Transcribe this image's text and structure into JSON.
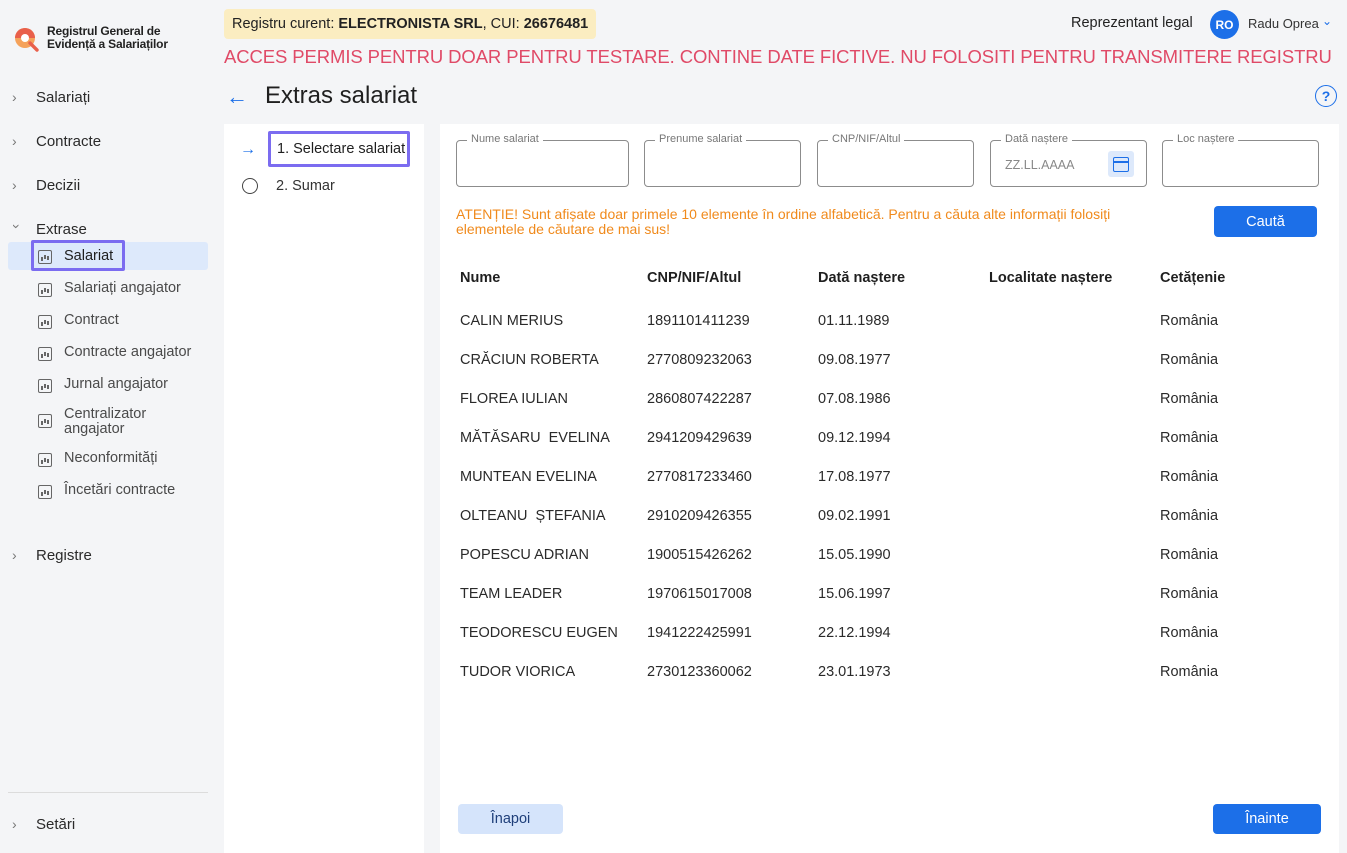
{
  "brand": {
    "line1": "Registrul General de",
    "line2": "Evidență a Salariaților"
  },
  "sidebar": {
    "groups": [
      {
        "label": "Salariați"
      },
      {
        "label": "Contracte"
      },
      {
        "label": "Decizii"
      },
      {
        "label": "Extrase"
      },
      {
        "label": "Registre"
      },
      {
        "label": "Setări"
      }
    ],
    "extrase_items": [
      {
        "label": "Salariat"
      },
      {
        "label": "Salariați angajator"
      },
      {
        "label": "Contract"
      },
      {
        "label": "Contracte angajator"
      },
      {
        "label": "Jurnal angajator"
      },
      {
        "label": "Centralizator angajator"
      },
      {
        "label": "Neconformități"
      },
      {
        "label": "Încetări contracte"
      }
    ]
  },
  "header": {
    "registry_prefix": "Registru curent: ",
    "company": "ELECTRONISTA SRL",
    "cui_prefix": ", CUI: ",
    "cui": "26676481",
    "role": "Reprezentant legal",
    "avatar_initials": "RO",
    "user_name": "Radu Oprea",
    "warning": "ACCES PERMIS PENTRU DOAR PENTRU TESTARE. CONTINE DATE FICTIVE. NU FOLOSITI PENTRU TRANSMITERE REGISTRU"
  },
  "page": {
    "title": "Extras salariat",
    "help": "?"
  },
  "steps": [
    {
      "label": "1. Selectare salariat"
    },
    {
      "label": "2. Sumar"
    }
  ],
  "search": {
    "fields": [
      {
        "label": "Nume salariat",
        "value": ""
      },
      {
        "label": "Prenume salariat",
        "value": ""
      },
      {
        "label": "CNP/NIF/Altul",
        "value": ""
      },
      {
        "label": "Dată naștere",
        "value": "ZZ.LL.AAAA"
      },
      {
        "label": "Loc naștere",
        "value": ""
      }
    ],
    "notice": "ATENȚIE! Sunt afișate doar primele 10 elemente în ordine alfabetică. Pentru a căuta alte informații folosiți elementele de căutare de mai sus!",
    "search_button": "Caută"
  },
  "table": {
    "headers": [
      "Nume",
      "CNP/NIF/Altul",
      "Dată naștere",
      "Localitate naștere",
      "Cetățenie"
    ],
    "rows": [
      [
        "CALIN MERIUS",
        "1891101411239",
        "01.11.1989",
        "",
        "România"
      ],
      [
        "CRĂCIUN ROBERTA",
        "2770809232063",
        "09.08.1977",
        "",
        "România"
      ],
      [
        "FLOREA IULIAN",
        "2860807422287",
        "07.08.1986",
        "",
        "România"
      ],
      [
        "MĂTĂSARU  EVELINA",
        "2941209429639",
        "09.12.1994",
        "",
        "România"
      ],
      [
        "MUNTEAN EVELINA",
        "2770817233460",
        "17.08.1977",
        "",
        "România"
      ],
      [
        "OLTEANU  ȘTEFANIA",
        "2910209426355",
        "09.02.1991",
        "",
        "România"
      ],
      [
        "POPESCU ADRIAN",
        "1900515426262",
        "15.05.1990",
        "",
        "România"
      ],
      [
        "TEAM LEADER",
        "1970615017008",
        "15.06.1997",
        "",
        "România"
      ],
      [
        "TEODORESCU EUGEN",
        "1941222425991",
        "22.12.1994",
        "",
        "România"
      ],
      [
        "TUDOR VIORICA",
        "2730123360062",
        "23.01.1973",
        "",
        "România"
      ]
    ]
  },
  "footer": {
    "back": "Înapoi",
    "next": "Înainte"
  },
  "colors": {
    "accent": "#1c6fe8",
    "warning": "#e04a67",
    "notice": "#f08a1c",
    "highlight": "#7b6cf0"
  }
}
